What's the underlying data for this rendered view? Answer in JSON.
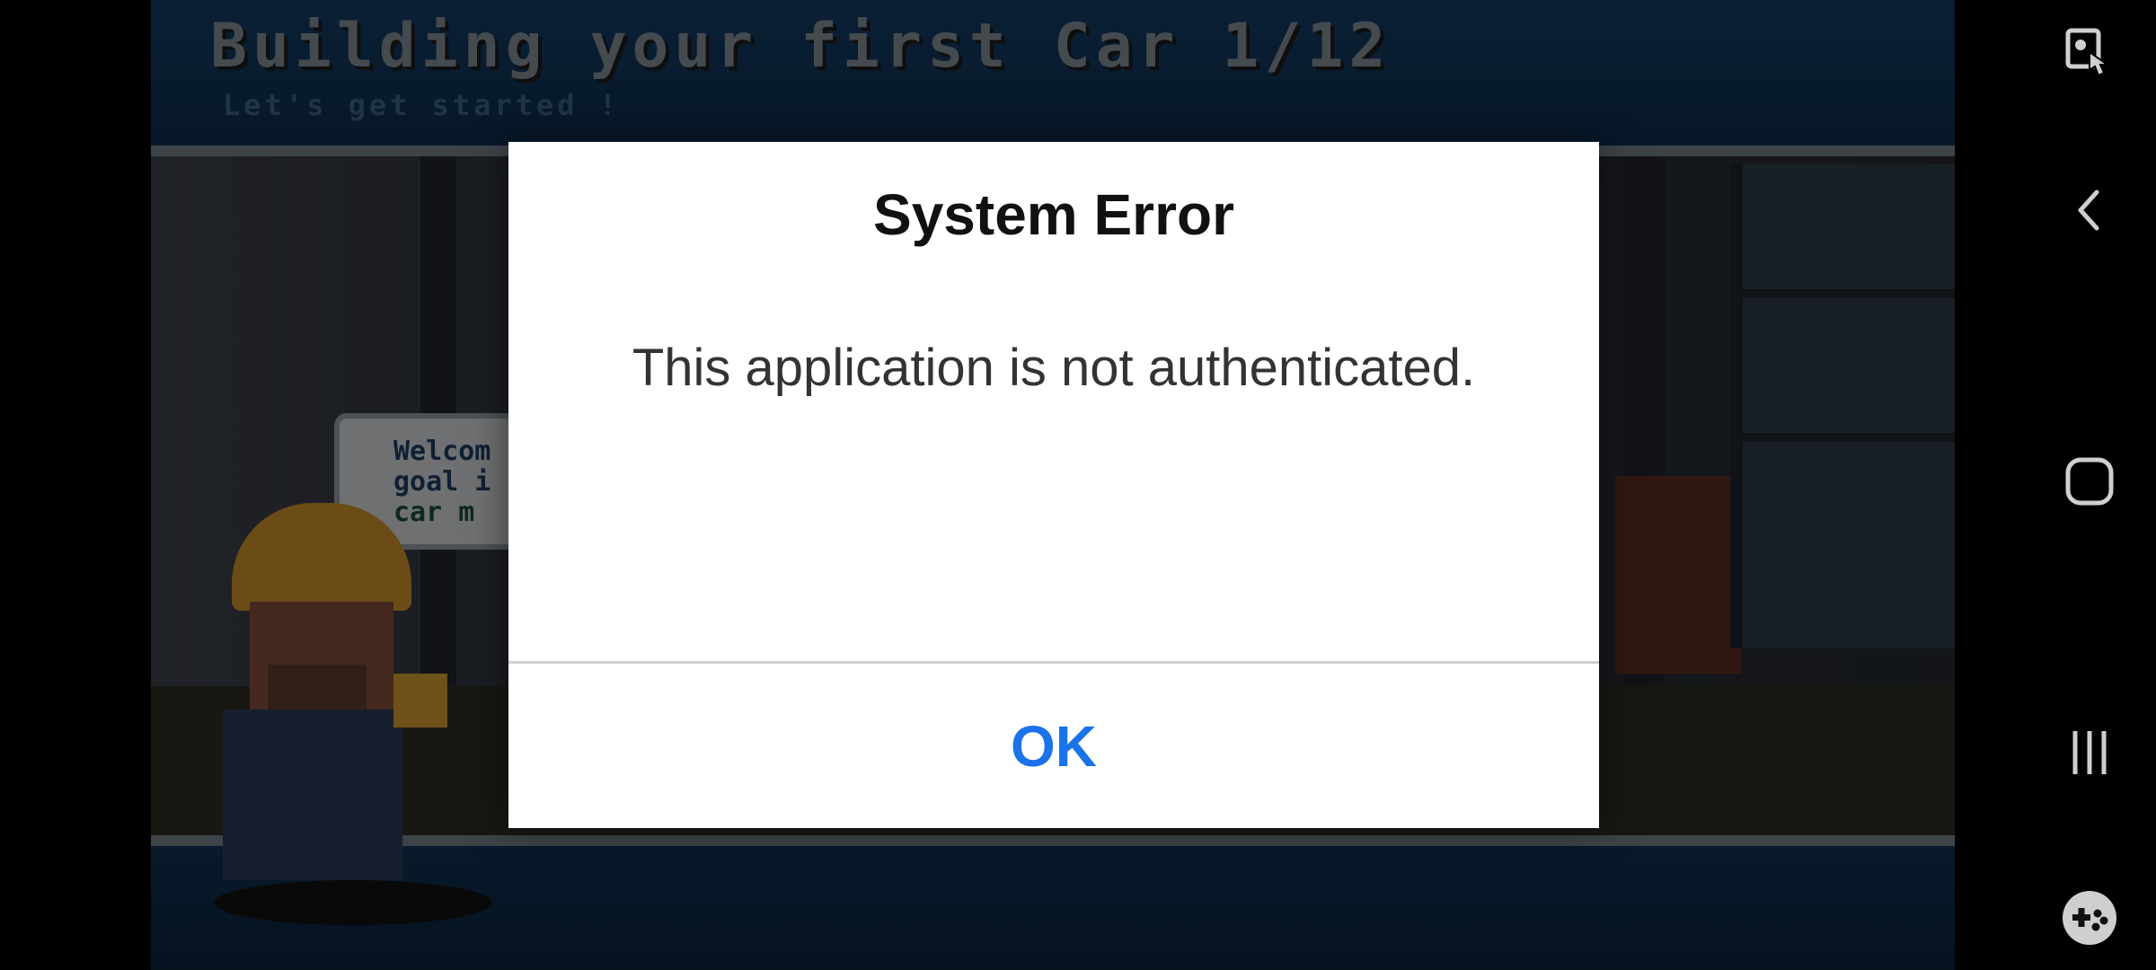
{
  "game": {
    "title": "Building your first Car 1/12",
    "subtitle": "Let's get started !",
    "speech_lines": [
      "Welcom",
      "goal i",
      "car m"
    ]
  },
  "dialog": {
    "title": "System Error",
    "message": "This application is not authenticated.",
    "ok_label": "OK"
  },
  "navigation": {
    "items": [
      "screenshot-edit-icon",
      "back-icon",
      "home-icon",
      "recent-apps-icon",
      "game-tools-icon"
    ]
  },
  "colors": {
    "accent": "#1a73e8",
    "banner": "#143a62"
  }
}
